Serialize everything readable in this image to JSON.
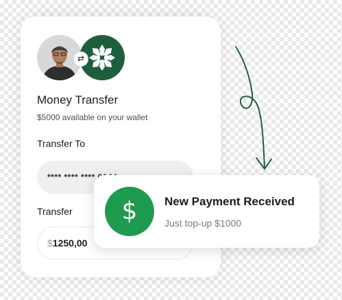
{
  "wallet": {
    "title": "Money Transfer",
    "balance_text": "$5000 available on your wallet",
    "transfer_to_label": "Transfer To",
    "card_number": "**** **** **** 0144",
    "transfer_label": "Transfer",
    "currency_symbol": "$",
    "amount": "1250,00",
    "swap_glyph": "⇄",
    "brand_color": "#1e5e3e"
  },
  "notification": {
    "icon_glyph": "$",
    "title": "New Payment Received",
    "subtitle": "Just top-up $1000",
    "accent_color": "#1f9a51"
  },
  "doodle": {
    "stroke_color": "#1e5e3e"
  }
}
